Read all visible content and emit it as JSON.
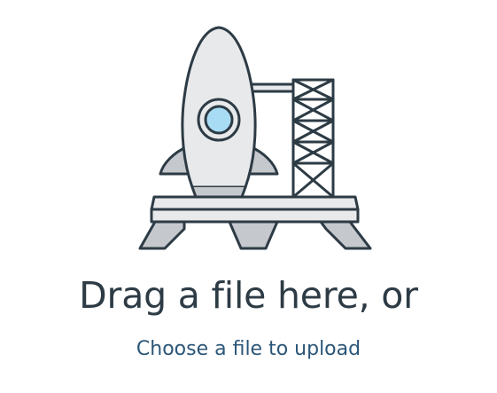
{
  "upload": {
    "headline": "Drag a file here, or",
    "link_label": "Choose a file to upload"
  },
  "icons": {
    "illustration": "rocket-launchpad-icon"
  },
  "colors": {
    "headline": "#2d3b45",
    "link": "#2b5678",
    "outline": "#2d3b45",
    "rocket_body": "#e8e9eb",
    "rocket_fins": "#c5c8cc",
    "window_glass": "#a8dcf5"
  }
}
